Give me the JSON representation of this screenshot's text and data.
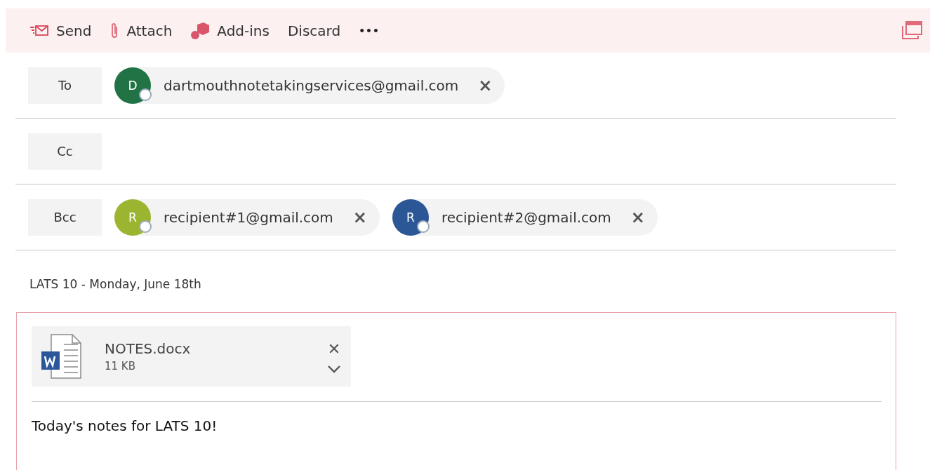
{
  "toolbar": {
    "buttons": [
      {
        "kind": "send",
        "label": "Send"
      },
      {
        "kind": "attach",
        "label": "Attach"
      },
      {
        "kind": "addins",
        "label": "Add-ins"
      },
      {
        "kind": "plain",
        "label": "Discard"
      },
      {
        "kind": "more",
        "label": "•••"
      }
    ]
  },
  "fields": [
    {
      "label": "To",
      "recipients": [
        {
          "initial": "D",
          "color": "#217346",
          "address": "dartmouthnotetakingservices@gmail.com",
          "remove": "×"
        }
      ]
    },
    {
      "label": "Cc"
    },
    {
      "label": "Bcc",
      "recipients": [
        {
          "initial": "R",
          "color": "#9cb531",
          "address": "recipient#1@gmail.com",
          "remove": "×"
        },
        {
          "initial": "R",
          "color": "#2b5797",
          "address": "recipient#2@gmail.com",
          "remove": "×"
        }
      ]
    }
  ],
  "subject": "LATS 10 - Monday, June 18th",
  "attachment": {
    "name": "NOTES.docx",
    "size": "11 KB",
    "remove": "✕"
  },
  "body": "Today's notes for LATS 10!"
}
